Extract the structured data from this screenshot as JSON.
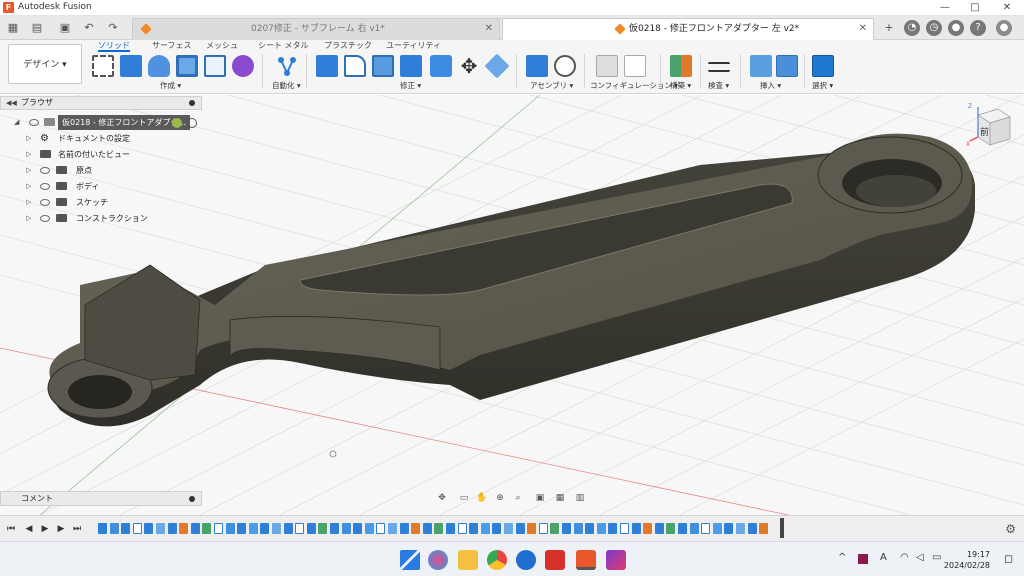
{
  "window": {
    "app_title": "Autodesk Fusion",
    "minimize": "—",
    "maximize": "□",
    "close": "✕"
  },
  "tabs": [
    {
      "label": "0207修正 - サブフレーム  右 v1*",
      "active": false
    },
    {
      "label": "仮0218 - 修正フロントアダプター  左 v2*",
      "active": true
    }
  ],
  "ribbon": {
    "workspace": "デザイン ▾",
    "tabs": [
      "ソリッド",
      "サーフェス",
      "メッシュ",
      "シート メタル",
      "プラスチック",
      "ユーティリティ"
    ],
    "active_tab": "ソリッド",
    "groups": [
      "作成 ▾",
      "自動化 ▾",
      "修正 ▾",
      "アセンブリ ▾",
      "コンフィギュレーション ▾",
      "構築 ▾",
      "検査 ▾",
      "挿入 ▾",
      "選択 ▾"
    ]
  },
  "browser": {
    "title": "ブラウザ",
    "root": "仮0218 - 修正フロントアダプタ...",
    "items": [
      {
        "label": "ドキュメントの設定"
      },
      {
        "label": "名前の付いたビュー"
      },
      {
        "label": "原点"
      },
      {
        "label": "ボディ"
      },
      {
        "label": "スケッチ"
      },
      {
        "label": "コンストラクション"
      }
    ]
  },
  "comments": {
    "title": "コメント"
  },
  "viewcube": {
    "face_label": "前",
    "axis_x": "X",
    "axis_z": "Z"
  },
  "taskbar": {
    "clock_time": "19:17",
    "clock_date": "2024/02/28",
    "ime": "A"
  },
  "colors": {
    "accent": "#0a6ad3",
    "orange": "#f08a24",
    "part": "#4a483f"
  }
}
